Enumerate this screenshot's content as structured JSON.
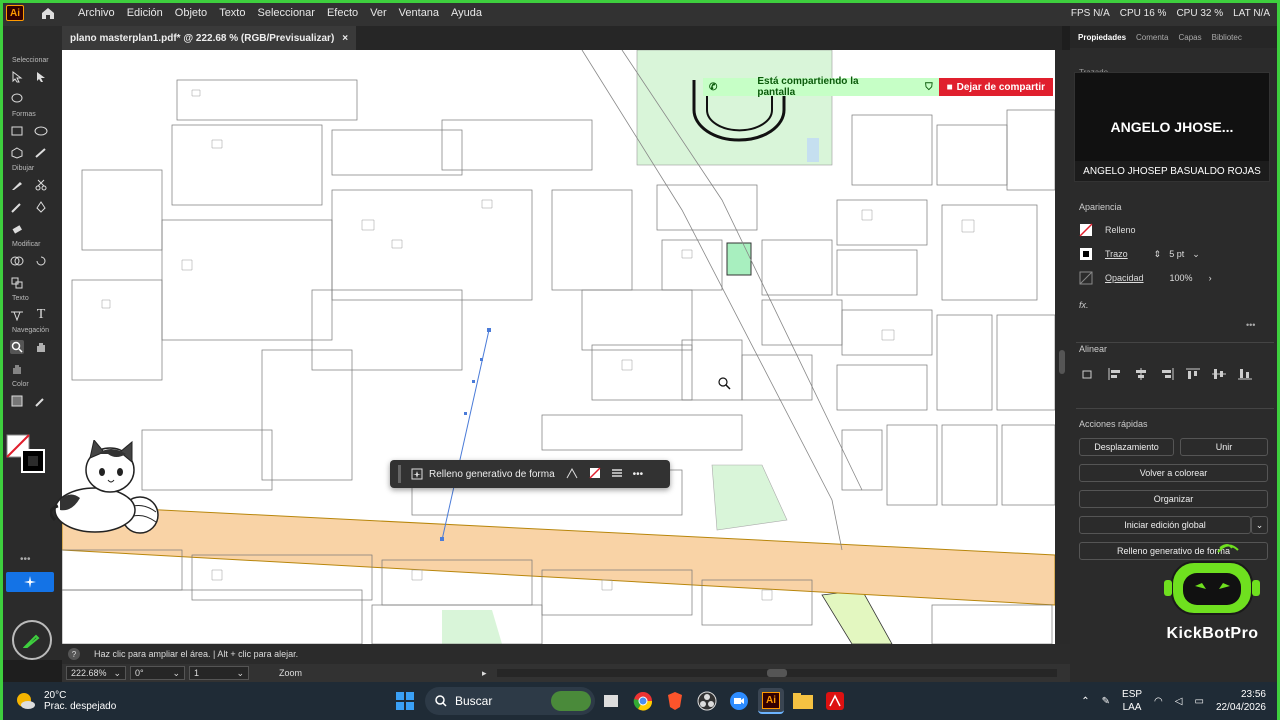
{
  "app": {
    "logo": "Ai",
    "menu": [
      "Archivo",
      "Edición",
      "Objeto",
      "Texto",
      "Seleccionar",
      "Efecto",
      "Ver",
      "Ventana",
      "Ayuda"
    ],
    "stats": [
      "FPS N/A",
      "CPU 16 %",
      "CPU 32 %",
      "LAT N/A"
    ]
  },
  "document": {
    "tab_title": "plano masterplan1.pdf* @ 222.68 % (RGB/Previsualizar)",
    "close": "×"
  },
  "toolbar": {
    "sections": [
      "Seleccionar",
      "Formas",
      "Dibujar",
      "Modificar",
      "Texto",
      "Navegación",
      "Color"
    ]
  },
  "share_banner": {
    "message": "Está compartiendo la pantalla",
    "stop_label": "Dejar de compartir"
  },
  "context_bar": {
    "label": "Relleno generativo de forma",
    "more": "•••"
  },
  "status": {
    "hint": "Haz clic para ampliar el área.  |  Alt + clic para alejar.",
    "zoom": "222.68%",
    "rotation": "0°",
    "artboard": "1",
    "tool": "Zoom"
  },
  "right_panel": {
    "tabs": [
      "Propiedades",
      "Comenta",
      "Capas",
      "Bibliotec"
    ],
    "partial_label": "Trazado",
    "camera_name_big": "ANGELO  JHOSE...",
    "camera_name_full": "ANGELO JHOSEP BASUALDO ROJAS",
    "appearance": {
      "title": "Apariencia",
      "fill": "Relleno",
      "stroke": "Trazo",
      "stroke_value": "5 pt",
      "opacity": "Opacidad",
      "opacity_value": "100%",
      "fx": "fx."
    },
    "align": {
      "title": "Alinear"
    },
    "quick_actions": {
      "title": "Acciones rápidas",
      "offset": "Desplazamiento",
      "join": "Unir",
      "recolor": "Volver a colorear",
      "arrange": "Organizar",
      "global_edit": "Iniciar edición global",
      "gen_fill": "Relleno generativo de forma"
    },
    "more": "•••"
  },
  "watermark": {
    "brand": "KickBotPro"
  },
  "taskbar": {
    "weather_temp": "20°C",
    "weather_desc": "Prac. despejado",
    "search": "Buscar",
    "lang": "ESP",
    "lang2": "LAA",
    "time": "23:56",
    "date": "22/04/2026"
  },
  "colors": {
    "road_orange": "#f9d3a6",
    "park_green": "#d9f5d9",
    "green_border": "#3ecf3e",
    "share_red": "#e01f2d"
  }
}
